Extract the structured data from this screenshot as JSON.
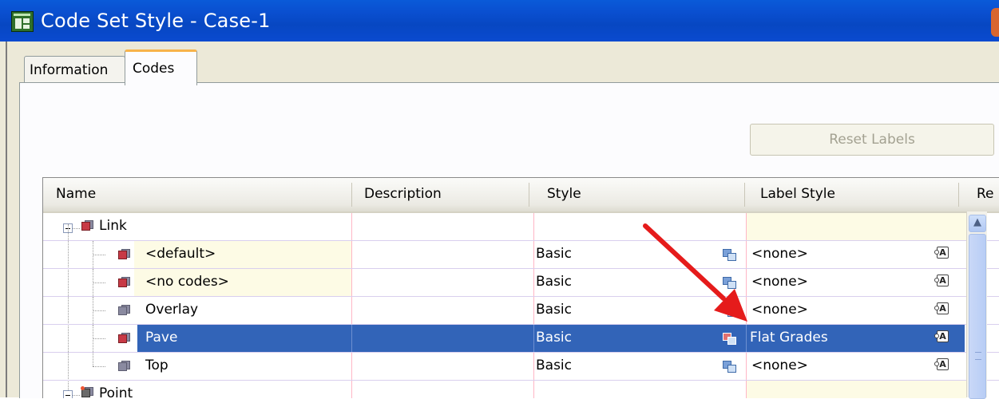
{
  "window": {
    "title": "Code Set Style - Case-1"
  },
  "tabs": [
    {
      "label": "Information"
    },
    {
      "label": "Codes"
    }
  ],
  "active_tab": "Codes",
  "reset_button": {
    "label": "Reset Labels"
  },
  "grid": {
    "columns": {
      "name": "Name",
      "description": "Description",
      "style": "Style",
      "label_style": "Label Style",
      "partial": "Re"
    },
    "groups": {
      "link": {
        "label": "Link"
      },
      "point": {
        "label": "Point"
      }
    },
    "rows": [
      {
        "name": "<default>",
        "description": "",
        "style": "Basic",
        "label_style": "<none>"
      },
      {
        "name": "<no codes>",
        "description": "",
        "style": "Basic",
        "label_style": "<none>"
      },
      {
        "name": "Overlay",
        "description": "",
        "style": "Basic",
        "label_style": "<none>"
      },
      {
        "name": "Pave",
        "description": "",
        "style": "Basic",
        "label_style": "Flat Grades",
        "selected": true
      },
      {
        "name": "Top",
        "description": "",
        "style": "Basic",
        "label_style": "<none>"
      }
    ]
  },
  "colors": {
    "selection": "#3264b8",
    "arrow": "#e51b1b",
    "title_bar": "#0a4fd0"
  },
  "icons": [
    "window-app-icon",
    "collapse-toggle",
    "code-icon",
    "style-picker-icon",
    "label-style-icon",
    "scroll-up-arrow"
  ]
}
